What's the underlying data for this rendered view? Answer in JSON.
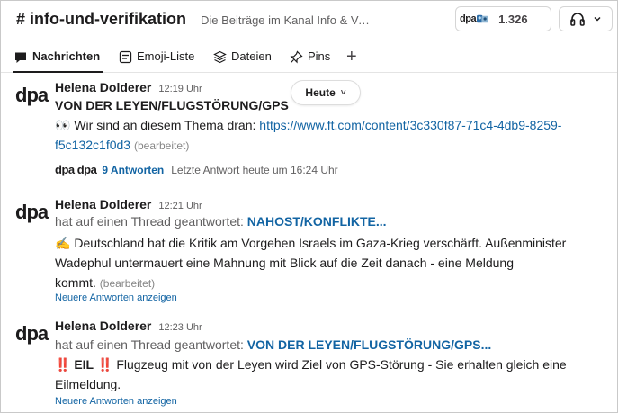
{
  "channel": {
    "name": "# info-und-verifikation",
    "description": "Die Beiträge im Kanal Info & Ve...",
    "member_logo": "dpa",
    "member_count": "1.326"
  },
  "tabs": [
    {
      "label": "Nachrichten",
      "icon": "message-icon",
      "active": true
    },
    {
      "label": "Emoji-Liste",
      "icon": "emoji-list-icon",
      "active": false
    },
    {
      "label": "Dateien",
      "icon": "files-icon",
      "active": false
    },
    {
      "label": "Pins",
      "icon": "pin-icon",
      "active": false
    }
  ],
  "add_tab": "+",
  "date_divider": {
    "label": "Heute",
    "chevron": "˅"
  },
  "messages": [
    {
      "avatar": "dpa",
      "author": "Helena Dolderer",
      "time": "12:19 Uhr",
      "title": "VON DER LEYEN/FLUGSTÖRUNG/GPS",
      "emoji": "👀",
      "text": "Wir sind an diesem Thema dran:",
      "link_part1": "https://www.ft.com/content/3c330f87-71c4-4db9-8259-",
      "link_part2": "f5c132c1f0d3",
      "edited": "(bearbeitet)",
      "reply_avatars": "dpa dpa",
      "reply_count": "9 Antworten",
      "reply_last": "Letzte Antwort heute um 16:24 Uhr"
    },
    {
      "avatar": "dpa",
      "author": "Helena Dolderer",
      "time": "12:21 Uhr",
      "thread_prefix": "hat auf einen Thread geantwortet:",
      "thread_title": "NAHOST/KONFLIKTE...",
      "emoji": "✍️",
      "line1": "Deutschland hat die Kritik am Vorgehen Israels im Gaza-Krieg verschärft. Außenminister",
      "line2": "Wadephul untermauert eine Mahnung mit Blick auf die Zeit danach - eine Meldung",
      "line3": "kommt.",
      "edited": "(bearbeitet)",
      "newer": "Neuere Antworten anzeigen"
    },
    {
      "avatar": "dpa",
      "author": "Helena Dolderer",
      "time": "12:23 Uhr",
      "thread_prefix": "hat auf einen Thread geantwortet:",
      "thread_title": "VON DER LEYEN/FLUGSTÖRUNG/GPS...",
      "bangs": "‼️",
      "tag": "EIL",
      "line1": "Flugzeug mit von der Leyen wird Ziel von GPS-Störung - Sie erhalten gleich eine",
      "line2": "Eilmeldung.",
      "newer": "Neuere Antworten anzeigen"
    }
  ],
  "colors": {
    "link": "#1264a3",
    "text": "#1d1c1d",
    "muted": "#616061",
    "bangs": "#e01e2c"
  }
}
